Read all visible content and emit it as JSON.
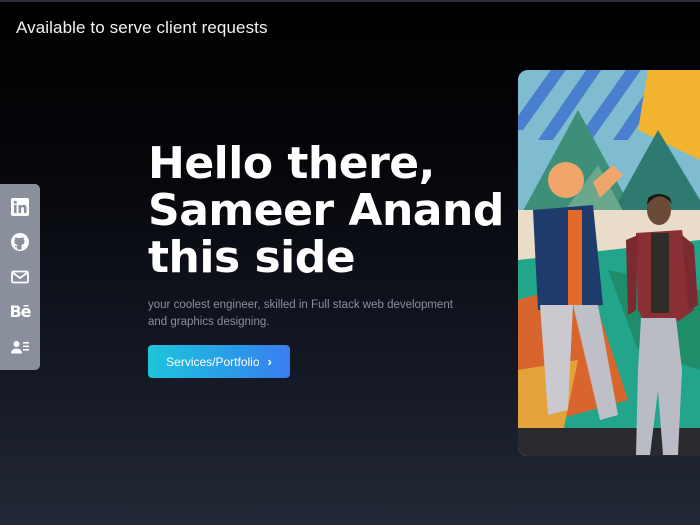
{
  "status_text": "Available to serve client requests",
  "social": [
    {
      "icon": "linkedin-icon"
    },
    {
      "icon": "github-icon"
    },
    {
      "icon": "mail-icon"
    },
    {
      "icon": "behance-icon",
      "glyph": "Bē"
    },
    {
      "icon": "contact-card-icon"
    }
  ],
  "hero": {
    "line1": "Hello there,",
    "line2": "Sameer Anand",
    "line3": "this side",
    "subtitle": "your coolest engineer, skilled in Full stack web development and graphics designing.",
    "cta_label": "Services/Portfolio",
    "cta_icon": "chevron-right-icon"
  },
  "colors": {
    "background_top": "#000000",
    "background_bottom": "#232836",
    "sidebar": "#8a8f9c",
    "cta_start": "#1fc4dc",
    "cta_end": "#3a7cf0"
  }
}
